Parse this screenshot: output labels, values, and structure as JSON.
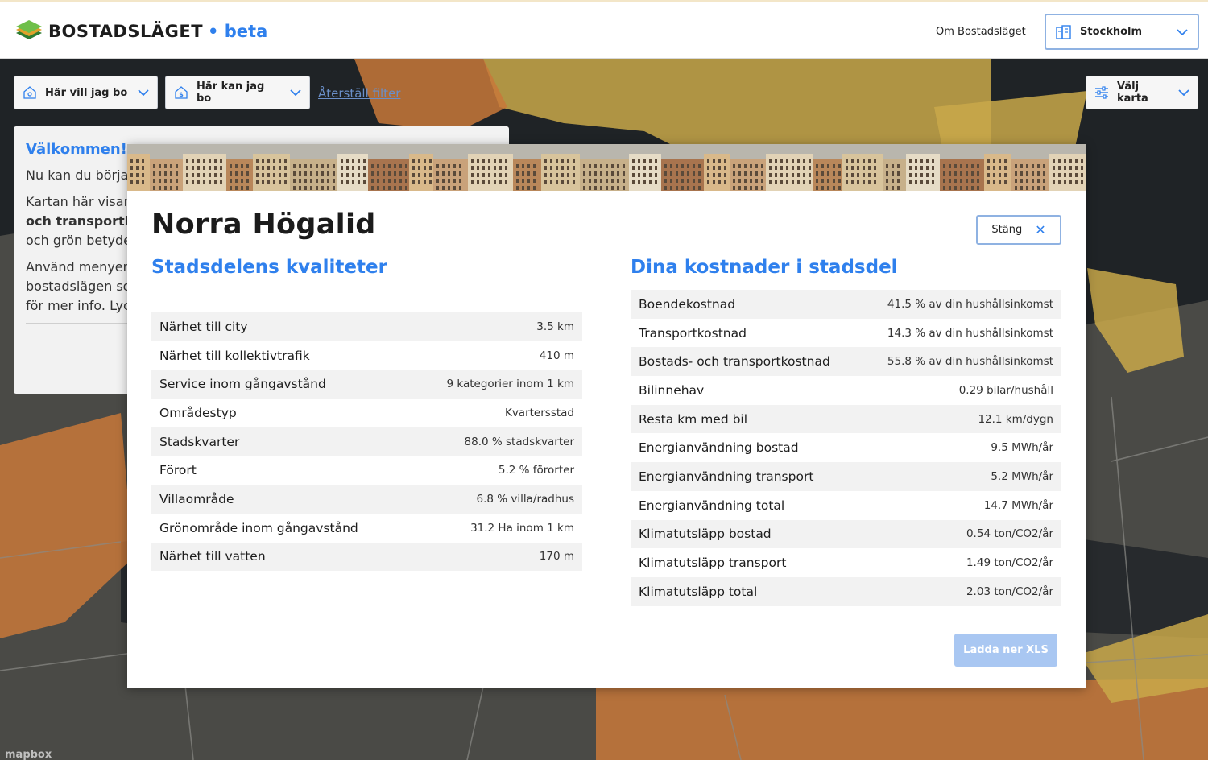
{
  "header": {
    "logo_text": "BOSTADSLÄGET",
    "logo_beta": "• beta",
    "nav_about": "Om Bostadsläget",
    "city_select": {
      "selected": "Stockholm",
      "icon": "buildings-icon"
    }
  },
  "filters": {
    "want_live": "Här vill jag bo",
    "can_live": "Här kan jag bo",
    "reset": "Återställ filter",
    "choose_map": "Välj karta"
  },
  "welcome": {
    "title": "Välkommen!",
    "p1": "Nu kan du börja",
    "p2a": "Kartan här visar l",
    "p2b": "och transportkos",
    "p2c": "och grön betyder",
    "p3a": "Använd menyern",
    "p3b": "bostadslägen so",
    "p3c": "för mer info. Lyck"
  },
  "modal": {
    "title": "Norra Högalid",
    "close_label": "Stäng",
    "qualities_title": "Stadsdelens kvaliteter",
    "costs_title": "Dina kostnader i stadsdel",
    "qualities": [
      {
        "label": "Närhet till city",
        "value": "3.5 km"
      },
      {
        "label": "Närhet till kollektivtrafik",
        "value": "410 m"
      },
      {
        "label": "Service inom gångavstånd",
        "value": "9 kategorier inom 1 km"
      },
      {
        "label": "Områdestyp",
        "value": "Kvartersstad"
      },
      {
        "label": "Stadskvarter",
        "value": "88.0 % stadskvarter"
      },
      {
        "label": "Förort",
        "value": "5.2 % förorter"
      },
      {
        "label": "Villaområde",
        "value": "6.8 % villa/radhus"
      },
      {
        "label": "Grönområde inom gångavstånd",
        "value": "31.2 Ha inom 1 km"
      },
      {
        "label": "Närhet till vatten",
        "value": "170 m"
      }
    ],
    "costs": [
      {
        "label": "Boendekostnad",
        "value": "41.5 % av din hushållsinkomst"
      },
      {
        "label": "Transportkostnad",
        "value": "14.3 % av din hushållsinkomst"
      },
      {
        "label": "Bostads- och transportkostnad",
        "value": "55.8 % av din hushållsinkomst"
      },
      {
        "label": "Bilinnehav",
        "value": "0.29 bilar/hushåll"
      },
      {
        "label": "Resta km med bil",
        "value": "12.1 km/dygn"
      },
      {
        "label": "Energianvändning bostad",
        "value": "9.5 MWh/år"
      },
      {
        "label": "Energianvändning transport",
        "value": "5.2 MWh/år"
      },
      {
        "label": "Energianvändning total",
        "value": "14.7 MWh/år"
      },
      {
        "label": "Klimatutsläpp bostad",
        "value": "0.54 ton/CO2/år"
      },
      {
        "label": "Klimatutsläpp transport",
        "value": "1.49 ton/CO2/år"
      },
      {
        "label": "Klimatutsläpp total",
        "value": "2.03 ton/CO2/år"
      }
    ],
    "download_label": "Ladda ner XLS"
  },
  "map": {
    "attribution": "mapbox"
  },
  "colors": {
    "accent": "#2f80ed",
    "orange_area": "#c8783a",
    "yellow_area": "#c9a84a"
  }
}
